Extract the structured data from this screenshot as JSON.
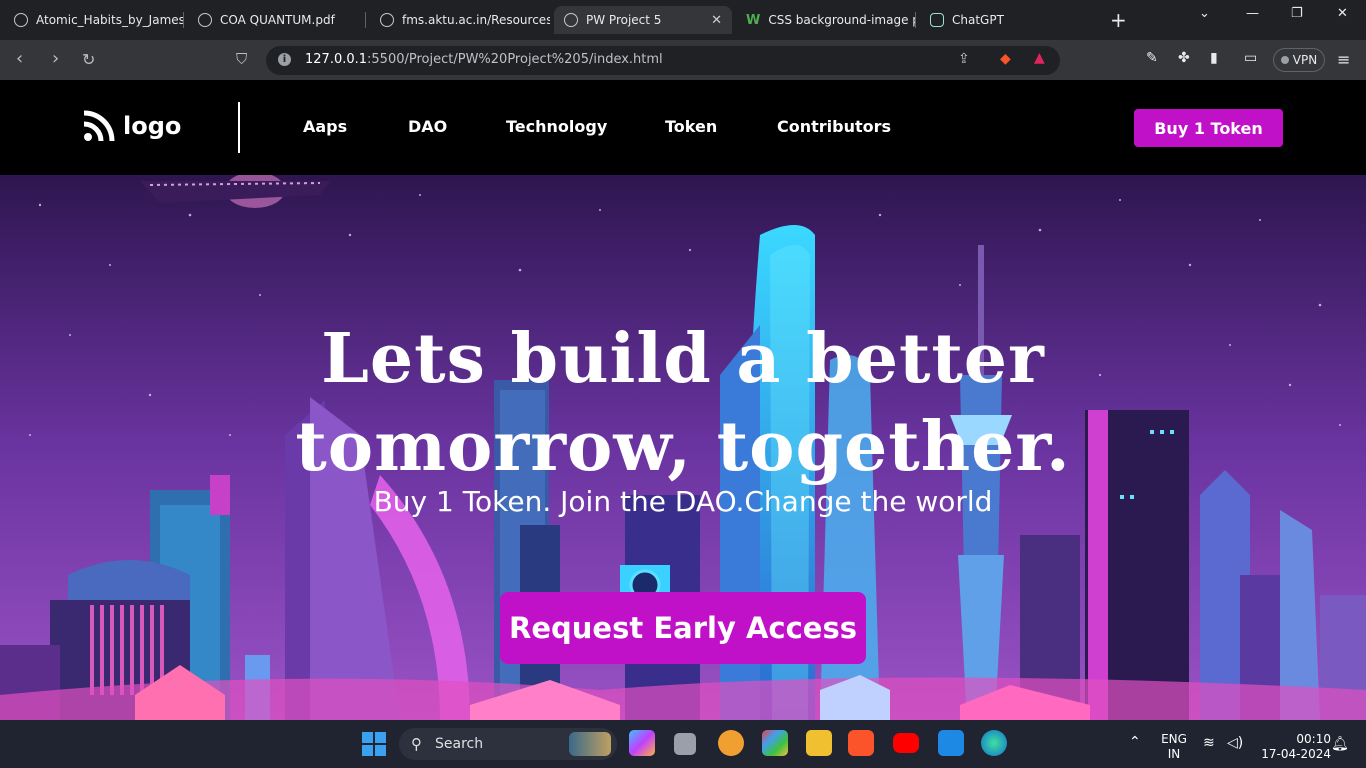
{
  "browser": {
    "tabs": [
      {
        "title": "Atomic_Habits_by_James_",
        "active": false
      },
      {
        "title": "COA QUANTUM.pdf",
        "active": false
      },
      {
        "title": "fms.aktu.ac.in/Resources/a",
        "active": false
      },
      {
        "title": "PW Project 5",
        "active": true
      },
      {
        "title": "CSS background-image p",
        "active": false
      },
      {
        "title": "ChatGPT",
        "active": false
      }
    ],
    "url_host": "127.0.0.1",
    "url_path": ":5500/Project/PW%20Project%205/index.html",
    "vpn_label": "VPN"
  },
  "site": {
    "logo_text": "logo",
    "nav": [
      "Aaps",
      "DAO",
      "Technology",
      "Token",
      "Contributors"
    ],
    "buy_button": "Buy 1 Token",
    "headline_line1": "Lets build a better",
    "headline_line2": "tomorrow, together.",
    "subline": "Buy 1 Token. Join the DAO.Change the world",
    "cta_button": "Request Early Access"
  },
  "taskbar": {
    "search_label": "Search",
    "lang_line1": "ENG",
    "lang_line2": "IN",
    "time": "00:10",
    "date": "17-04-2024"
  },
  "colors": {
    "accent": "#c010c8",
    "nav_bg": "#000000",
    "browser_chrome": "#202124",
    "taskbar_bg": "#1f2430"
  }
}
